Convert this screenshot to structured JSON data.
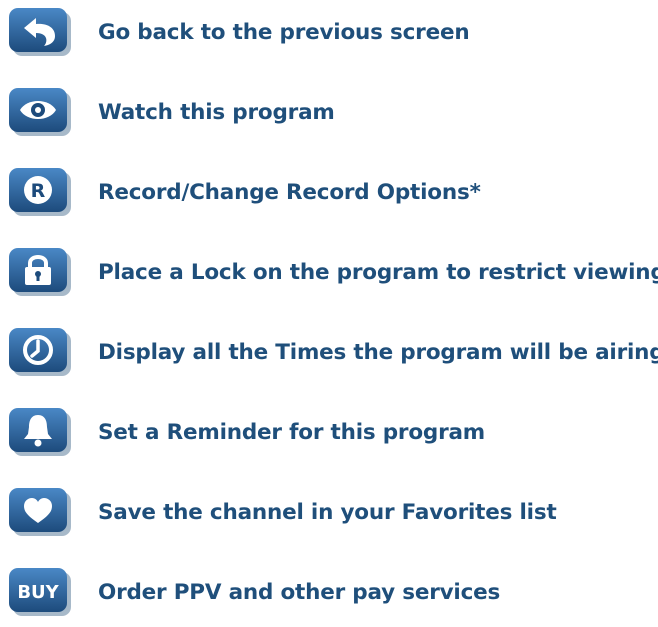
{
  "legend": {
    "items": [
      {
        "icon": "back-arrow-icon",
        "label": "Go back to the previous screen"
      },
      {
        "icon": "eye-icon",
        "label": "Watch this program"
      },
      {
        "icon": "record-r-icon",
        "label": "Record/Change Record Options*"
      },
      {
        "icon": "padlock-icon",
        "label": "Place a Lock on the program to restrict viewing"
      },
      {
        "icon": "clock-icon",
        "label": "Display all the Times the program will be airing"
      },
      {
        "icon": "bell-icon",
        "label": "Set a Reminder for this program"
      },
      {
        "icon": "heart-icon",
        "label": "Save the channel in your Favorites list"
      },
      {
        "icon": "buy-icon",
        "buy_text": "BUY",
        "label": "Order PPV and other pay services"
      }
    ]
  },
  "colors": {
    "button_light": "#3f7bb8",
    "button_dark": "#163b63",
    "text": "#1f4f7b",
    "glyph": "#ffffff"
  }
}
